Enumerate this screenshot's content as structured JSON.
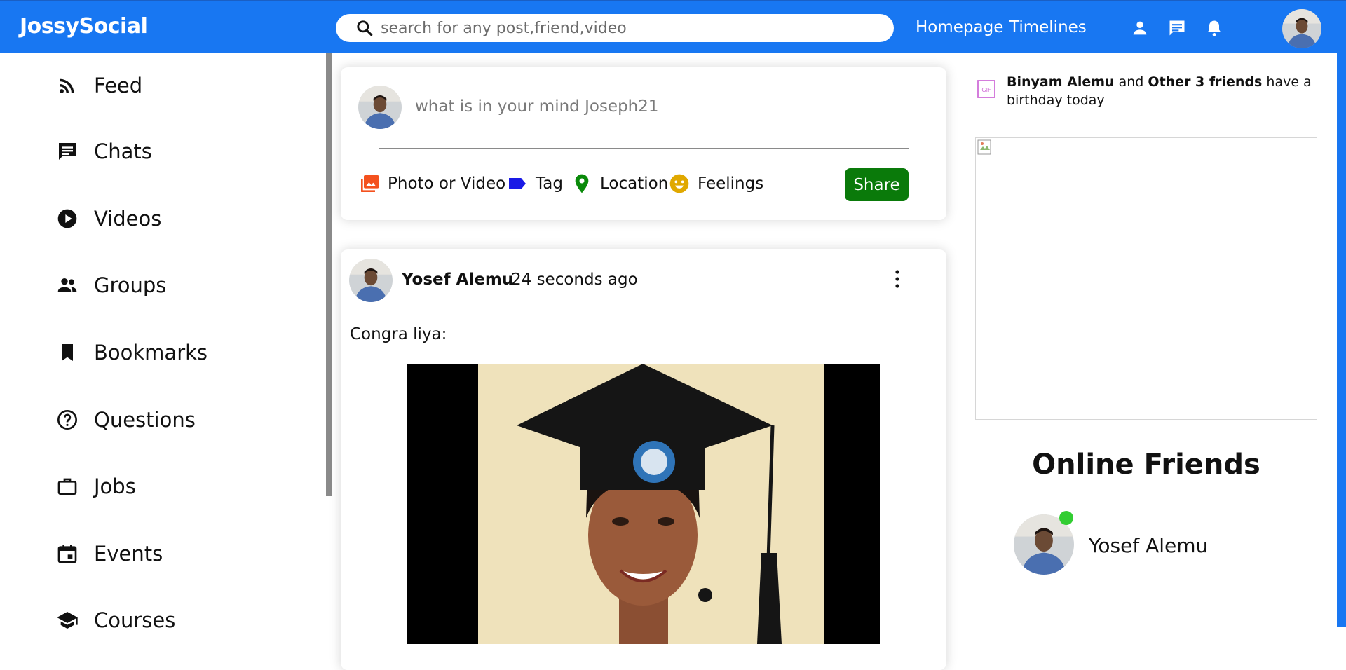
{
  "header": {
    "logo": "JossySocial",
    "search_placeholder": "search for any post,friend,video",
    "links": [
      "Homepage",
      "Timelines"
    ],
    "icons": [
      "person-icon",
      "chat-icon",
      "notification-icon"
    ]
  },
  "sidebar": {
    "items": [
      {
        "label": "Feed",
        "icon": "rss-feed-icon"
      },
      {
        "label": "Chats",
        "icon": "chat-icon"
      },
      {
        "label": "Videos",
        "icon": "play-circle-icon"
      },
      {
        "label": "Groups",
        "icon": "group-icon"
      },
      {
        "label": "Bookmarks",
        "icon": "bookmark-icon"
      },
      {
        "label": "Questions",
        "icon": "help-circle-icon"
      },
      {
        "label": "Jobs",
        "icon": "work-icon"
      },
      {
        "label": "Events",
        "icon": "event-icon"
      },
      {
        "label": "Courses",
        "icon": "school-icon"
      }
    ]
  },
  "share": {
    "placeholder": "what is in your mind Joseph21",
    "options": [
      {
        "label": "Photo or Video",
        "icon": "photo-library-icon",
        "color": "#f4511e"
      },
      {
        "label": "Tag",
        "icon": "label-icon",
        "color": "#1a1ae6"
      },
      {
        "label": "Location",
        "icon": "location-pin-icon",
        "color": "#0a8a0a"
      },
      {
        "label": "Feelings",
        "icon": "emoji-icon",
        "color": "#e0a800"
      }
    ],
    "button": "Share"
  },
  "post": {
    "author": "Yosef Alemu",
    "time": "24 seconds ago",
    "text": "Congra liya:"
  },
  "birthday": {
    "name": "Binyam Alemu",
    "and": "and",
    "others": "Other 3 friends",
    "suffix": "have a birthday today"
  },
  "online": {
    "title": "Online Friends",
    "friends": [
      {
        "name": "Yosef Alemu",
        "status": "online"
      }
    ]
  },
  "colors": {
    "brand": "#1877f2",
    "share_button": "#0a7a0a",
    "online_dot": "#32cd32"
  }
}
